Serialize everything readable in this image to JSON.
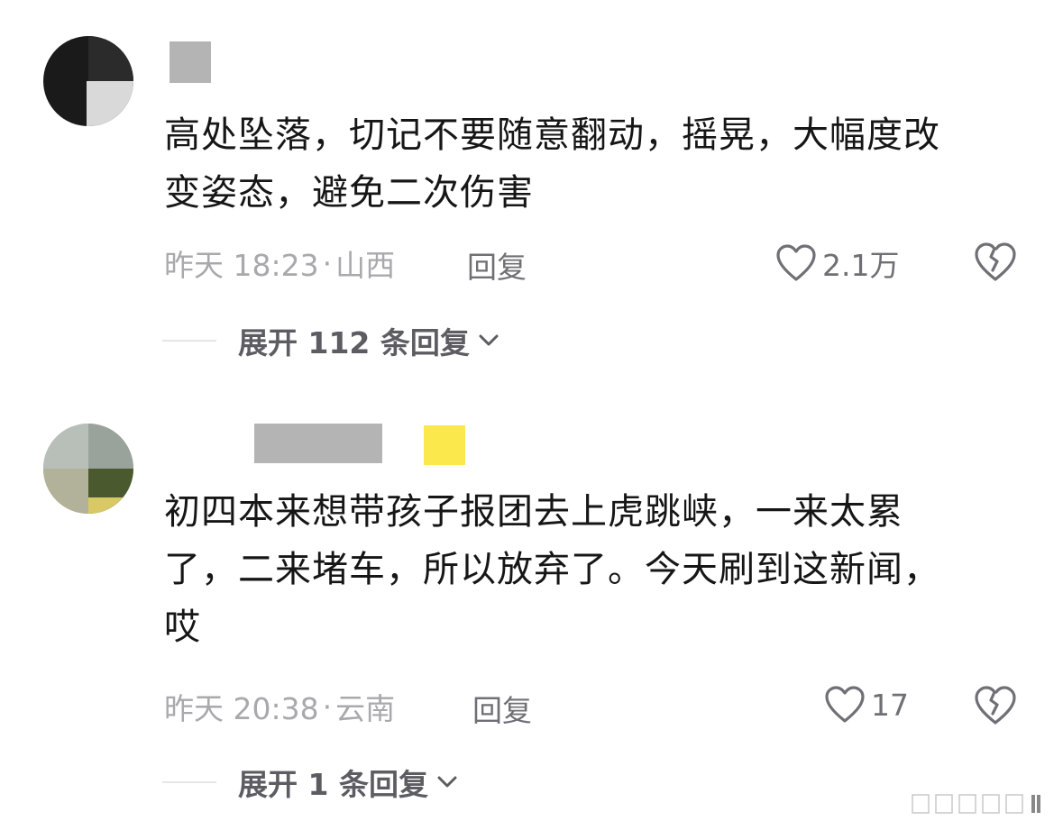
{
  "comments": [
    {
      "text_line1": "高处坠落，切记不要随意翻动，摇晃，大幅度改",
      "text_line2": "变姿态，避免二次伤害",
      "time": "昨天 18:23",
      "location": "山西",
      "reply_label": "回复",
      "likes": "2.1万",
      "expand_label": "展开 112 条回复"
    },
    {
      "text_line1": "初四本来想带孩子报团去上虎跳峡，一来太累",
      "text_line2": "了，二来堵车，所以放弃了。今天刷到这新闻，",
      "text_line3": "哎",
      "time": "昨天 20:38",
      "location": "云南",
      "reply_label": "回复",
      "likes": "17",
      "expand_label": "展开 1 条回复"
    }
  ],
  "separator": "·",
  "icons": {
    "like": "heart-outline-icon",
    "dislike": "broken-heart-icon",
    "expand": "chevron-down-icon"
  },
  "colors": {
    "text": "#161616",
    "meta": "#a9a9ad",
    "action": "#6f6f75",
    "censor_gray": "#b4b4b4",
    "censor_yellow": "#fbe84c"
  }
}
